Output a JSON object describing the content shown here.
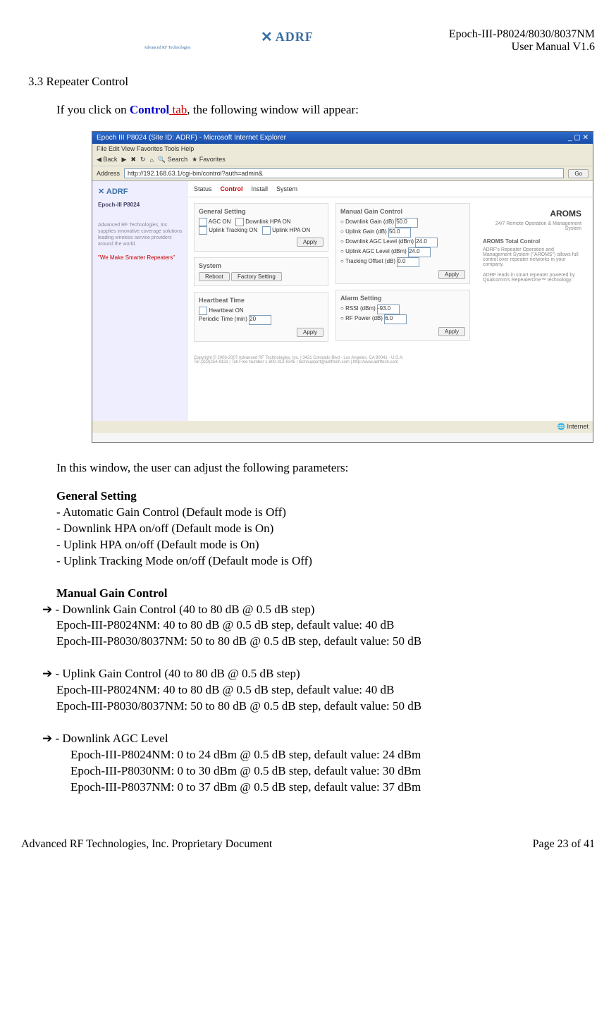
{
  "header": {
    "logo_brand": "ADRF",
    "logo_sub": "Advanced RF Technologies",
    "doc_title1": "Epoch-III-P8024/8030/8037NM",
    "doc_title2": "User Manual V1.6"
  },
  "section": {
    "num_title": "3.3 Repeater Control",
    "intro_pre": "If you click on ",
    "intro_blue": "Control",
    "intro_red": " tab",
    "intro_post": ", the following window will appear:"
  },
  "screenshot": {
    "title": "Epoch III P8024 (Site ID: ADRF) - Microsoft Internet Explorer",
    "menu": "File   Edit   View   Favorites   Tools   Help",
    "back": "Back",
    "search": "Search",
    "favorites": "Favorites",
    "address_lbl": "Address",
    "address_val": "http://192.168.63.1/cgi-bin/control?auth=admin&",
    "go": "Go",
    "side_brand": "ADRF",
    "side_model": "Epoch-III P8024",
    "side_desc": "Advanced RF Technologies, Inc. supplies innovative coverage solutions leading wireless service providers around the world.",
    "side_slogan": "\"We Make Smarter Repeaters\"",
    "tabs": {
      "status": "Status",
      "control": "Control",
      "install": "Install",
      "system": "System"
    },
    "aroms": "AROMS",
    "aroms_sub": "24/7 Remote Operation & Management System",
    "gs": {
      "title": "General Setting",
      "agc": "AGC ON",
      "dlhpa": "Downlink HPA ON",
      "track": "Uplink Tracking ON",
      "ulhpa": "Uplink HPA ON",
      "apply": "Apply"
    },
    "sys": {
      "title": "System",
      "reboot": "Reboot",
      "factory": "Factory Setting"
    },
    "hb": {
      "title": "Heartbeat Time",
      "on": "Heartbeat ON",
      "period": "Periodic Time (min)",
      "val": "20",
      "apply": "Apply"
    },
    "mgc": {
      "title": "Manual Gain Control",
      "dlgain": "Downlink Gain (dB)",
      "ulgain": "Uplink Gain (dB)",
      "dlagc": "Downlink AGC Level (dBm)",
      "ulagc": "Uplink AGC Level (dBm)",
      "track": "Tracking Offset (dB)",
      "v1": "50.0",
      "v2": "50.0",
      "v3": "24.0",
      "v4": "24.0",
      "v5": "0.0",
      "apply": "Apply"
    },
    "alarm": {
      "title": "Alarm Setting",
      "vswr": "RSSI (dBm)",
      "rfpwr": "RF Power (dB)",
      "v1": "-93.0",
      "v2": "6.0",
      "apply": "Apply"
    },
    "rbox": {
      "title": "AROMS Total Control",
      "desc": "ADRF's Repeater Operation and Management System (\"AROMS\") allows full control over repeater networks in your company.",
      "desc2": "ADRF leads in smart repeater powered by Qualcomm's RepeaterOne™ technology."
    },
    "copyright": "Copyright © 2006-2007 Advanced RF Technologies, Inc. | 3421 Colorado Blvd · Los Angeles, CA 90041 · U.S.A.",
    "copyright2": "Tel (323)254-8131 | Toll Free Number 1-800-313-9345 | techsupport@adrftech.com | http://www.adrftech.com",
    "status_bar": "Internet"
  },
  "body": {
    "window_intro": "In this window, the user can adjust the following parameters:",
    "gs_title": "General Setting",
    "gs_l1": "- Automatic Gain Control (Default mode is Off)",
    "gs_l2": "- Downlink HPA on/off (Default mode is On)",
    "gs_l3": "- Uplink HPA on/off (Default mode is On)",
    "gs_l4": "- Uplink Tracking Mode on/off (Default mode is Off)",
    "mgc_title": "Manual Gain Control",
    "mgc_a1": " - Downlink Gain Control (40 to 80 dB @ 0.5 dB step)",
    "mgc_a1_l1": "Epoch-III-P8024NM: 40 to 80 dB @ 0.5 dB step, default value: 40 dB",
    "mgc_a1_l2": "Epoch-III-P8030/8037NM: 50 to 80 dB @ 0.5 dB step, default value: 50 dB",
    "mgc_a2": " - Uplink Gain Control (40 to 80 dB @ 0.5 dB step)",
    "mgc_a2_l1": "Epoch-III-P8024NM: 40 to 80 dB @ 0.5 dB step, default value: 40 dB",
    "mgc_a2_l2": "Epoch-III-P8030/8037NM: 50 to 80 dB @ 0.5 dB step, default value: 50 dB",
    "mgc_a3": " - Downlink AGC Level",
    "mgc_a3_l1": "Epoch-III-P8024NM: 0 to 24 dBm @ 0.5 dB step, default value: 24 dBm",
    "mgc_a3_l2": "Epoch-III-P8030NM: 0 to 30 dBm @ 0.5 dB step, default value: 30 dBm",
    "mgc_a3_l3": "Epoch-III-P8037NM: 0 to 37 dBm @ 0.5 dB step, default value: 37 dBm",
    "arrow": "➔"
  },
  "footer": {
    "left": "Advanced RF Technologies, Inc. Proprietary Document",
    "right": "Page 23 of 41"
  }
}
